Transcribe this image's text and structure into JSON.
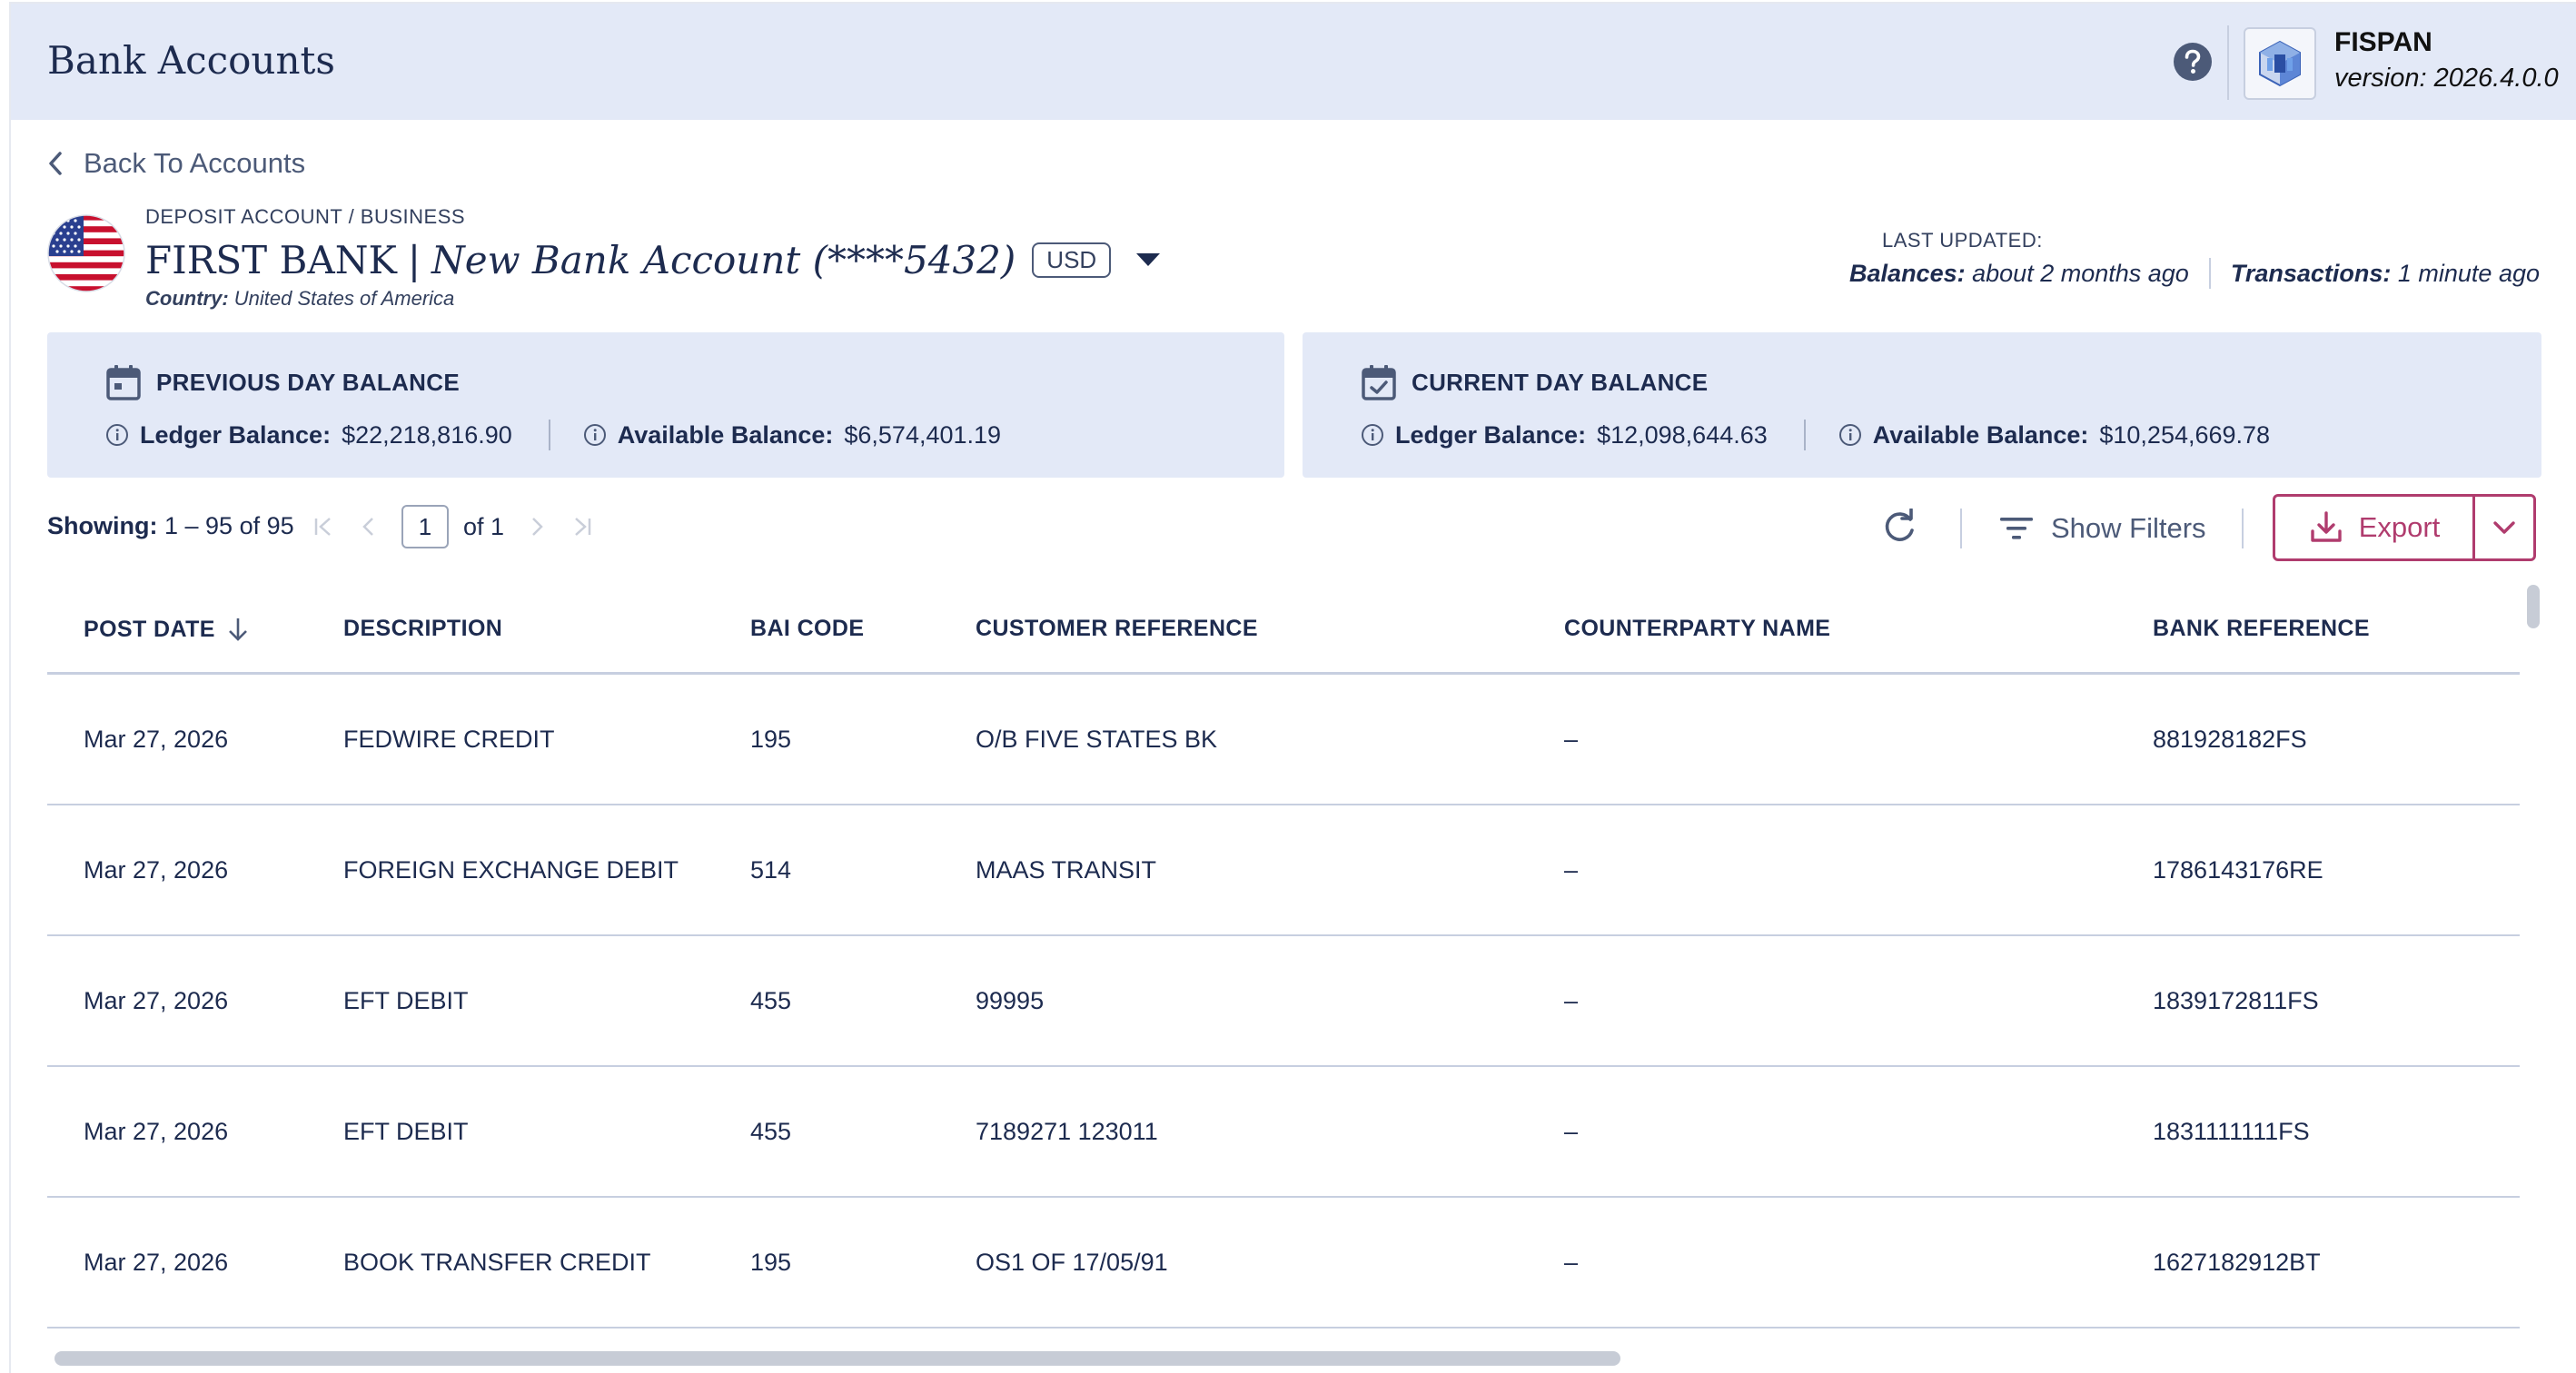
{
  "header": {
    "title": "Bank Accounts",
    "brand": "FISPAN",
    "version": "version: 2026.4.0.0"
  },
  "back_link": "Back To Accounts",
  "account": {
    "type": "DEPOSIT ACCOUNT / BUSINESS",
    "bank": "FIRST BANK",
    "separator": "|",
    "name": "New Bank Account (****5432)",
    "currency": "USD",
    "country_label": "Country:",
    "country": "United States of America"
  },
  "last_updated": {
    "label": "LAST UPDATED:",
    "balances_label": "Balances:",
    "balances_value": "about 2 months ago",
    "transactions_label": "Transactions:",
    "transactions_value": "1 minute ago"
  },
  "balances": {
    "previous": {
      "title": "PREVIOUS DAY BALANCE",
      "ledger_label": "Ledger Balance:",
      "ledger_value": "$22,218,816.90",
      "available_label": "Available Balance:",
      "available_value": "$6,574,401.19"
    },
    "current": {
      "title": "CURRENT DAY BALANCE",
      "ledger_label": "Ledger Balance:",
      "ledger_value": "$12,098,644.63",
      "available_label": "Available Balance:",
      "available_value": "$10,254,669.78"
    }
  },
  "toolbar": {
    "showing_label": "Showing:",
    "showing_value": "1 – 95 of 95",
    "page": "1",
    "of_pages": "of 1",
    "show_filters": "Show Filters",
    "export": "Export"
  },
  "table": {
    "columns": [
      "POST DATE",
      "DESCRIPTION",
      "BAI CODE",
      "CUSTOMER REFERENCE",
      "COUNTERPARTY NAME",
      "BANK REFERENCE"
    ],
    "rows": [
      [
        "Mar 27, 2026",
        "FEDWIRE CREDIT",
        "195",
        "O/B FIVE STATES BK",
        "–",
        "881928182FS"
      ],
      [
        "Mar 27, 2026",
        "FOREIGN EXCHANGE DEBIT",
        "514",
        "MAAS TRANSIT",
        "–",
        "1786143176RE"
      ],
      [
        "Mar 27, 2026",
        "EFT DEBIT",
        "455",
        "99995",
        "–",
        "1839172811FS"
      ],
      [
        "Mar 27, 2026",
        "EFT DEBIT",
        "455",
        "7189271 123011",
        "–",
        "1831111111FS"
      ],
      [
        "Mar 27, 2026",
        "BOOK TRANSFER CREDIT",
        "195",
        "OS1 OF 17/05/91",
        "–",
        "1627182912BT"
      ]
    ]
  },
  "icons": {
    "help": "help-icon",
    "back": "chevron-left-icon",
    "calendar": "calendar-icon",
    "calendar_check": "calendar-check-icon",
    "info": "info-icon",
    "refresh": "refresh-icon",
    "filter": "filter-icon",
    "download": "download-icon",
    "sort": "arrow-down-icon"
  },
  "colors": {
    "header_bg": "#e3e9f7",
    "text": "#1d2b4f",
    "accent": "#b03c6e",
    "muted": "#4c5a78"
  }
}
